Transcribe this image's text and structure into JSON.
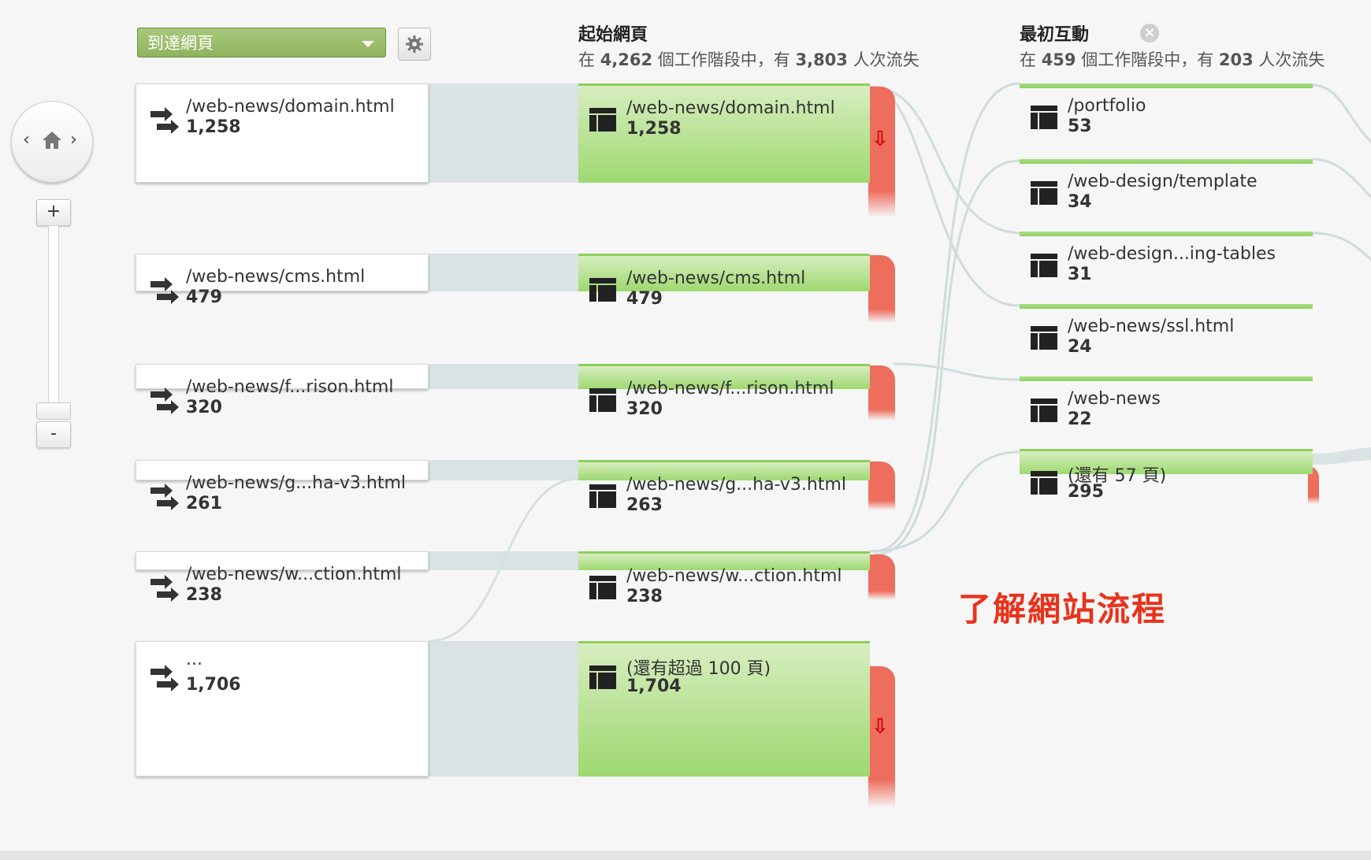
{
  "toolbar": {
    "dimension_label": "到達網頁",
    "settings_icon": "gear-icon"
  },
  "columns": {
    "start": {
      "title": "起始網頁",
      "sub_prefix": "在 ",
      "sessions": "4,262",
      "sub_mid": " 個工作階段中，有 ",
      "dropoffs": "3,803",
      "sub_suffix": " 人次流失"
    },
    "first": {
      "title": "最初互動",
      "sub_prefix": "在 ",
      "sessions": "459",
      "sub_mid": " 個工作階段中，有 ",
      "dropoffs": "203",
      "sub_suffix": " 人次流失"
    }
  },
  "navigator": {
    "prev": "‹",
    "next": "›",
    "home_icon": "home-icon",
    "zoom_in": "+",
    "zoom_out": "-"
  },
  "source_nodes": [
    {
      "label": "/web-news/domain.html",
      "count": "1,258"
    },
    {
      "label": "/web-news/cms.html",
      "count": "479"
    },
    {
      "label": "/web-news/f...rison.html",
      "count": "320"
    },
    {
      "label": "/web-news/g...ha-v3.html",
      "count": "261"
    },
    {
      "label": "/web-news/w...ction.html",
      "count": "238"
    },
    {
      "label": "...",
      "count": "1,706"
    }
  ],
  "start_nodes": [
    {
      "label": "/web-news/domain.html",
      "count": "1,258"
    },
    {
      "label": "/web-news/cms.html",
      "count": "479"
    },
    {
      "label": "/web-news/f...rison.html",
      "count": "320"
    },
    {
      "label": "/web-news/g...ha-v3.html",
      "count": "263"
    },
    {
      "label": "/web-news/w...ction.html",
      "count": "238"
    },
    {
      "label": "(還有超過 100 頁)",
      "count": "1,704"
    }
  ],
  "interaction_nodes": [
    {
      "label": "/portfolio",
      "count": "53"
    },
    {
      "label": "/web-design/template",
      "count": "34"
    },
    {
      "label": "/web-design...ing-tables",
      "count": "31"
    },
    {
      "label": "/web-news/ssl.html",
      "count": "24"
    },
    {
      "label": "/web-news",
      "count": "22"
    },
    {
      "label": "(還有 57 頁)",
      "count": "295"
    }
  ],
  "annotation": "了解網站流程",
  "colors": {
    "node_green": "#9ed870",
    "dropoff_red": "#ee6e5d",
    "annotation_red": "#e8331c",
    "flow_gray": "#dae3e3"
  }
}
